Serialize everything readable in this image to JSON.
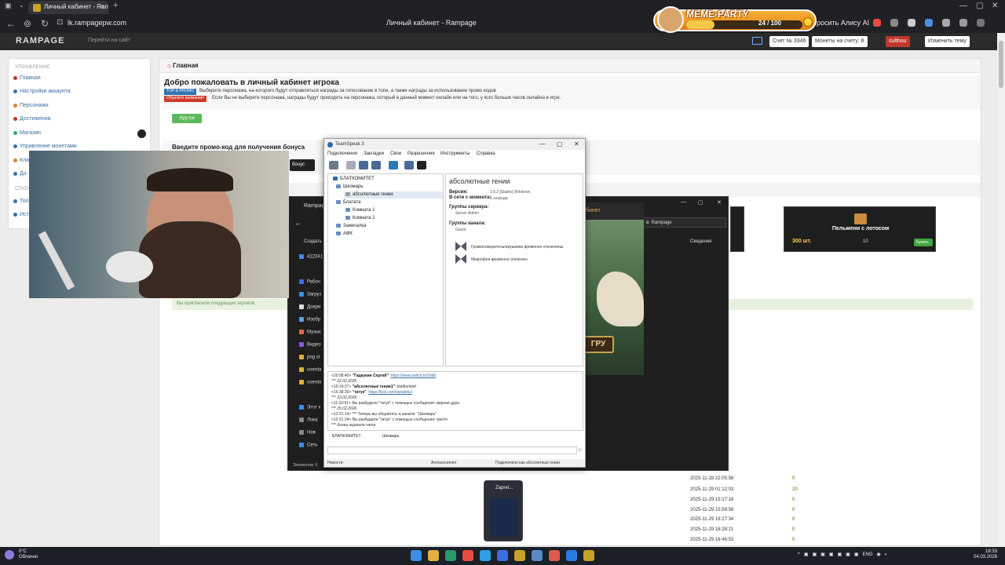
{
  "browser": {
    "tab_title": "Личный кабинет - Rampa",
    "url": "lk.rampagepw.com",
    "page_title": "Личный кабинет - Rampage",
    "ask_alisa": "росить Алису AI"
  },
  "meme_party": {
    "title": "MEME-PARTY",
    "counter": "24 / 100",
    "progress": 0.24
  },
  "site": {
    "logo": "RAMPAGE",
    "go_site": "Перейти на сайт",
    "account_label": "Счет № 3346",
    "coins_label": "Монеты на счету: 8",
    "user_label": "sulthou",
    "theme_label": "Изменить тему"
  },
  "sidebar": {
    "section_title": "УПРАВЛЕНИЕ",
    "items": [
      {
        "label": "Главная",
        "color": "#c0392b"
      },
      {
        "label": "Настройки аккаунта",
        "color": "#2f75b5"
      },
      {
        "label": "Персонажи",
        "color": "#e67e22"
      },
      {
        "label": "Достижения",
        "color": "#c0392b"
      },
      {
        "label": "Магазин",
        "color": "#27ae60"
      },
      {
        "label": "Управление монетами",
        "color": "#2f75b5"
      },
      {
        "label": "Клан",
        "color": "#e67e22"
      },
      {
        "label": "До",
        "color": "#2f75b5"
      }
    ],
    "section2_title": "СТАТИ",
    "items2": [
      {
        "label": "Топ"
      },
      {
        "label": "Ист"
      }
    ]
  },
  "main": {
    "breadcrumb": "Главная",
    "welcome_title": "Добро пожаловать в личный кабинет игрока",
    "badge_top": "TOP & PROMO",
    "line1": "Выберите персонажа, на которого будут отправляться награды за голосование в топе, а также награды за использование промо кодов",
    "badge_warn": "Обратите внимание!",
    "line2": "Если Вы не выберете персонажа, награды будут приходить на персонажа, который в данный момент онлайн или на того, у кого больше часов онлайна в игре.",
    "cool_button": "Крутое",
    "promo_title": "Введите промо-код для получения бонуса",
    "promo_button": "бонус",
    "invite_text": "Вы пригласили следующих игроков:"
  },
  "shop": {
    "item_name": "Пельмени с лотосом",
    "qty": "300 шт.",
    "price": "10",
    "buy": "Купить"
  },
  "history": {
    "rows": [
      {
        "date": "2025-11-28 22:05:58",
        "coins": "0"
      },
      {
        "date": "2025-11-29 01:12:03",
        "coins": "20"
      },
      {
        "date": "2025-11-29 15:17:18",
        "coins": "0"
      },
      {
        "date": "2025-11-29 15:58:58",
        "coins": "0"
      },
      {
        "date": "2025-11-29 16:27:34",
        "coins": "0"
      },
      {
        "date": "2025-11-29 16:28:21",
        "coins": "0"
      },
      {
        "date": "2025-11-29 16:46:53",
        "coins": "0"
      }
    ]
  },
  "explorer": {
    "title": "Rampage",
    "create": "Создать",
    "search": "в: Rampage",
    "details": "Сведения",
    "sidebar": [
      "412341",
      "Рабоч",
      "Загруз",
      "Докум",
      "Изобр",
      "Музык",
      "Видео",
      "png st",
      "userda",
      "userda",
      "Этот к",
      "Лока",
      "Нов",
      "Сеть"
    ],
    "status": "Элементов: 6"
  },
  "game": {
    "title": "бинет",
    "button": "ГРУ"
  },
  "teamspeak": {
    "title": "TeamSpeak 3",
    "menu": [
      "Подключения",
      "Закладки",
      "Свои",
      "Разрешения",
      "Инструменты",
      "Справка"
    ],
    "tree": [
      {
        "label": "БЛАТКОМИТЕТ",
        "level": 0
      },
      {
        "label": "Шкомарь",
        "level": 1
      },
      {
        "label": "абсолютные гении",
        "level": 2
      },
      {
        "label": "Блатата",
        "level": 1
      },
      {
        "label": "Комната 1",
        "level": 2
      },
      {
        "label": "Комната 2",
        "level": 2
      },
      {
        "label": "Зажигалка",
        "level": 1
      },
      {
        "label": "АФК",
        "level": 1
      }
    ],
    "info": {
      "name": "абсолютные гении",
      "version_k": "Версия:",
      "version_v": "3.6.2 [Stable] Windows",
      "online_k": "В сети с момента:",
      "online_v": "1 секунда",
      "server_groups_k": "Группы сервера:",
      "server_group": "Server Admin",
      "channel_groups_k": "Группы канала:",
      "channel_group": "Guest",
      "speaker_off": "Громкоговоритель/наушники временно отключены",
      "mic_off": "Микрофон временно отключен"
    },
    "chat": [
      {
        "time": "<20:08:40>",
        "name": "\"Гадкукин Сергей\"",
        "text": ":",
        "link": "https://www.twitch.tv/2dd0"
      },
      {
        "time": "***",
        "name": "",
        "text": "22.02.2026",
        "link": ""
      },
      {
        "time": "<15:14:27>",
        "name": "\"абсолютные гении1\"",
        "text": ": blatkomitet",
        "link": ""
      },
      {
        "time": "<15:38:36>",
        "name": "\"татук\"",
        "text": ":",
        "link": "https://kck.com/rawaleksi"
      },
      {
        "time": "***",
        "name": "",
        "text": "23.02.2026",
        "link": ""
      },
      {
        "time": "<11:23:51>",
        "name": "",
        "text": "Вы разбудили \"татук\" с помощью сообщения: жирная дура",
        "link": ""
      },
      {
        "time": "***",
        "name": "",
        "text": "25.02.2026",
        "link": ""
      },
      {
        "time": "<12:21:14>",
        "name": "",
        "text": "*** Теперь вы общаетесь в канале: \"Шкомарь\"",
        "link": ""
      },
      {
        "time": "<12:21:24>",
        "name": "",
        "text": "Вы разбудили \"татук\" с помощью сообщения: хрютя",
        "link": ""
      },
      {
        "time": "***",
        "name": "",
        "text": "Конец журнала чата",
        "link": ""
      }
    ],
    "tabs": [
      "БЛАТКОМИТЕТ",
      "Шкомарь"
    ],
    "status_news": "Новости:",
    "status_ann": "Announcemen",
    "status_conn": "Подключено как абсолютные гении"
  },
  "taskbar": {
    "temp": "0°C",
    "weather": "Облачно",
    "lang": "ENG",
    "time": "18:33",
    "date": "04.03.2026",
    "zapret": "Zapret..."
  }
}
